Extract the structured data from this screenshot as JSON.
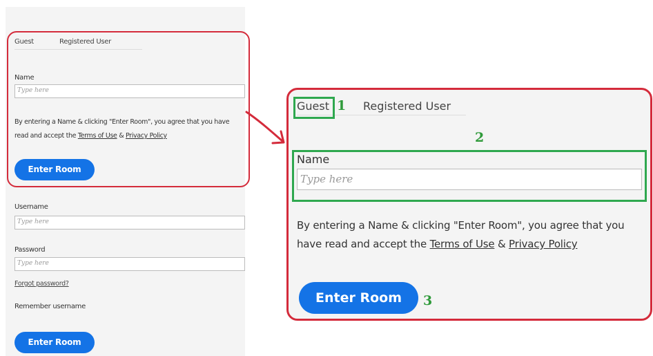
{
  "small_form": {
    "tabs": [
      "Guest",
      "Registered User"
    ],
    "guest": {
      "name_label": "Name",
      "name_placeholder": "Type here",
      "consent_prefix": "By entering a Name & clicking \"Enter Room\", you agree that you have read and accept the ",
      "terms_link": "Terms of Use",
      "amp": " & ",
      "privacy_link": "Privacy Policy",
      "enter_button": "Enter Room"
    },
    "registered": {
      "username_label": "Username",
      "username_placeholder": "Type here",
      "password_label": "Password",
      "password_placeholder": "Type here",
      "forgot_link": "Forgot password?",
      "remember_label": "Remember username",
      "enter_button": "Enter Room"
    }
  },
  "zoomed_form": {
    "tabs": [
      "Guest",
      "Registered User"
    ],
    "name_label": "Name",
    "name_placeholder": "Type here",
    "consent_prefix": "By entering a Name & clicking \"Enter Room\", you agree that you have read and accept the ",
    "terms_link": "Terms of Use",
    "amp": " & ",
    "privacy_link": "Privacy Policy",
    "enter_button": "Enter Room"
  },
  "annotations": {
    "step_1": "1",
    "step_2": "2",
    "step_3": "3"
  },
  "colors": {
    "highlight_red": "#d42b3b",
    "highlight_green": "#2fa84f",
    "button_blue": "#1473e6",
    "panel_bg": "#f4f4f4"
  }
}
